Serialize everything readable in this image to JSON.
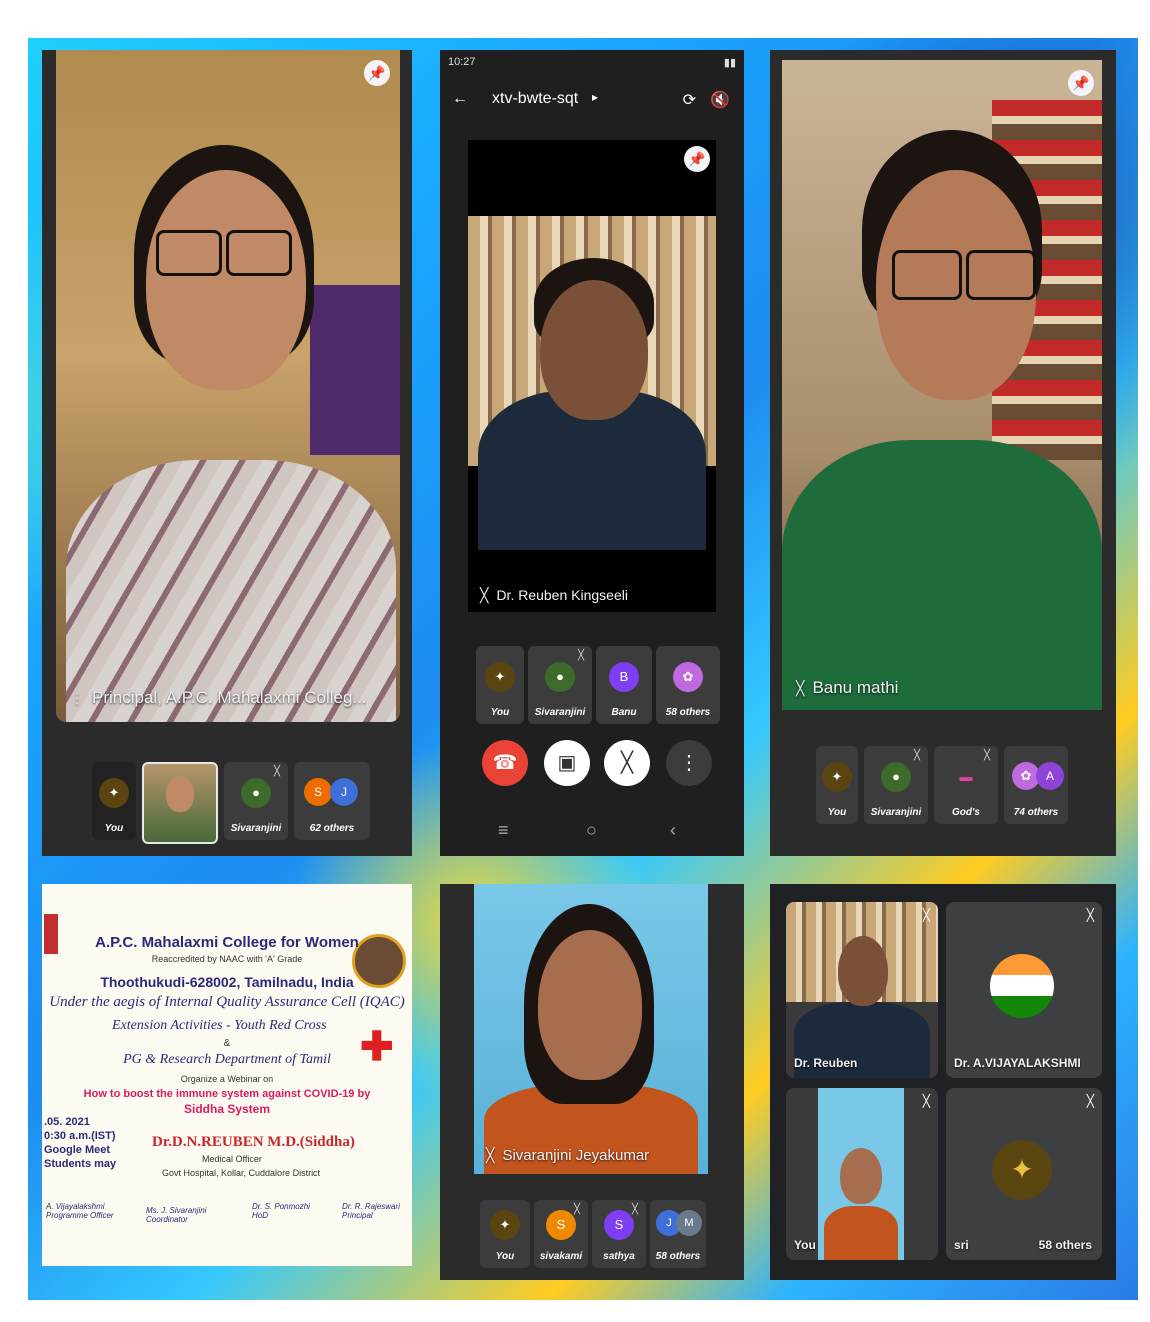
{
  "p1": {
    "caption": "Principal, A.P.C. Mahalaxmi Colleg...",
    "tiles": [
      "You",
      "",
      "Sivaranjini",
      "62 others"
    ],
    "avatars": [
      "S",
      "J"
    ]
  },
  "p2": {
    "status_time": "10:27",
    "meeting_code": "xtv-bwte-sqt",
    "caption": "Dr. Reuben Kingseeli",
    "tiles": [
      "You",
      "Sivaranjini",
      "Banu",
      "58 others"
    ],
    "avatar_b": "B"
  },
  "p3": {
    "caption": "Banu mathi",
    "tiles": [
      "You",
      "Sivaranjini",
      "God's",
      "74 others"
    ],
    "avatar_a": "A"
  },
  "poster": {
    "college": "A.P.C. Mahalaxmi College for Women",
    "accredit": "Reaccredited by NAAC with 'A' Grade",
    "city": "Thoothukudi-628002, Tamilnadu, India",
    "aegis": "Under the aegis of Internal Quality Assurance Cell (IQAC)",
    "extension": "Extension Activities - Youth Red Cross",
    "amp": "&",
    "dept": "PG & Research Department of Tamil",
    "organize": "Organize a Webinar on",
    "topic": "How to boost the immune system against COVID-19 by",
    "system": "Siddha System",
    "date": ".05. 2021",
    "time": "0:30 a.m.(IST)",
    "platform": "Google Meet",
    "students": "Students may",
    "speaker": "Dr.D.N.REUBEN M.D.(Siddha)",
    "office": "Medical Officer",
    "hospital": "Govt Hospital, Kollar, Cuddalore District",
    "c1_name": "A. Vijayalakshmi",
    "c1_role": "Programme Officer",
    "c2_name": "Ms. J. Sivaranjini",
    "c2_role": "Coordinator",
    "c3_name": "Dr. S. Ponmozhi",
    "c3_role": "HoD",
    "c4_name": "Dr. R. Rajeswari",
    "c4_role": "Principal"
  },
  "p5": {
    "caption": "Sivaranjini Jeyakumar",
    "tiles": [
      "You",
      "sivakami",
      "sathya",
      "58 others"
    ],
    "avatars": [
      "S",
      "S",
      "J",
      "M"
    ]
  },
  "p6": {
    "cell1": "Dr. Reuben",
    "cell2": "Dr. A.VIJAYALAKSHMI",
    "cell3": "You",
    "cell4": "sri",
    "others": "58 others"
  }
}
